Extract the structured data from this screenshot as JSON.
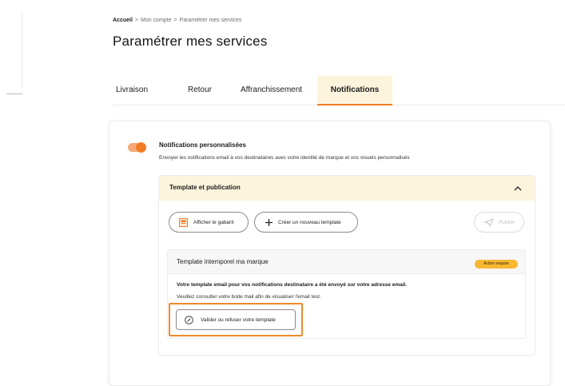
{
  "breadcrumb": {
    "home": "Accueil",
    "separator": ">",
    "account": "Mon compte",
    "current": "Paramétrer mes services"
  },
  "page_title": "Paramétrer mes services",
  "tabs": [
    {
      "label": "Livraison",
      "active": false
    },
    {
      "label": "Retour",
      "active": false
    },
    {
      "label": "Affranchissement",
      "active": false
    },
    {
      "label": "Notifications",
      "active": true
    }
  ],
  "notifications": {
    "toggle_on": true,
    "title": "Notifications personnalisées",
    "description": "Envoyer les notifications email à vos destinataires avec votre identité de marque et vos visuels personnalisés"
  },
  "accordion": {
    "title": "Template et publication",
    "expanded": true,
    "buttons": {
      "show_template": "Afficher le gabarit",
      "create_template": "Créer un nouveau template",
      "publish": "Publier"
    }
  },
  "template": {
    "name": "Template intemporel ma marque",
    "status_badge": "Action requise",
    "line1": "Votre template email pour vos notifications destinataire a été envoyé sur votre adresse email.",
    "line2": "Veuillez consulter votre boite mail afin de visualiser l'email test.",
    "validate_label": "Valider ou refuser votre template"
  },
  "colors": {
    "accent": "#f07d26",
    "tab_active_bg": "#fdf4dd",
    "badge_bg": "#f8b731"
  },
  "icons": {
    "show_template": "template-preview-icon",
    "create_template": "plus-icon",
    "publish": "send-icon",
    "validate": "edit-circle-icon",
    "accordion": "chevron-up-icon"
  }
}
